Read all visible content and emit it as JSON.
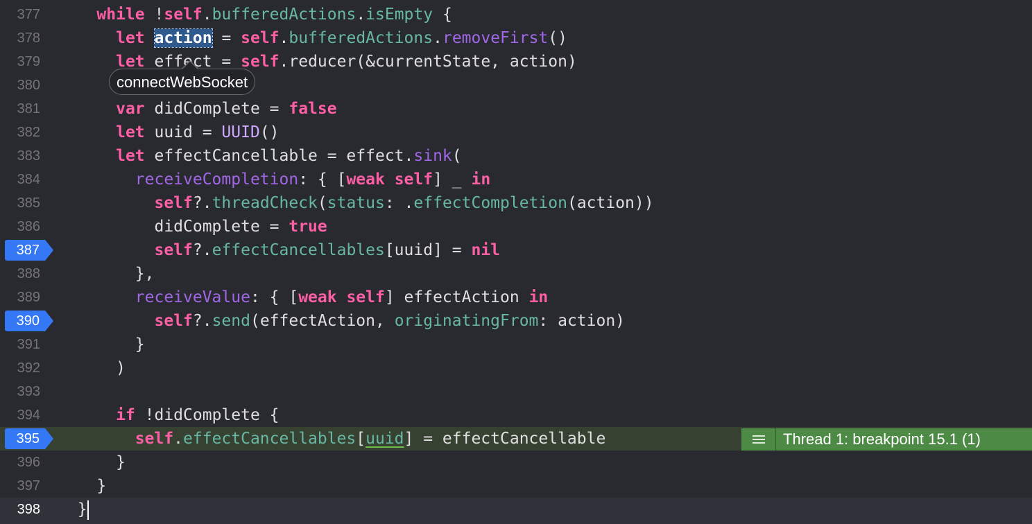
{
  "tooltip": {
    "text": "connectWebSocket"
  },
  "thread_badge": {
    "icon": "list-icon",
    "text": "Thread 1: breakpoint 15.1 (1)",
    "color": "#4d8a45"
  },
  "breakpoint_color": "#3478f6",
  "lines": [
    {
      "num": "377",
      "tokens": [
        [
          "p",
          "    "
        ],
        [
          "k",
          "while"
        ],
        [
          "p",
          " !"
        ],
        [
          "s",
          "self"
        ],
        [
          "p",
          "."
        ],
        [
          "r",
          "bufferedActions"
        ],
        [
          "p",
          "."
        ],
        [
          "r",
          "isEmpty"
        ],
        [
          "p",
          " {"
        ]
      ]
    },
    {
      "num": "378",
      "tokens": [
        [
          "p",
          "      "
        ],
        [
          "k",
          "let"
        ],
        [
          "p",
          " "
        ],
        [
          "x",
          "action"
        ],
        [
          "p",
          " = "
        ],
        [
          "s",
          "self"
        ],
        [
          "p",
          "."
        ],
        [
          "r",
          "bufferedActions"
        ],
        [
          "p",
          "."
        ],
        [
          "m",
          "removeFirst"
        ],
        [
          "p",
          "()"
        ]
      ]
    },
    {
      "num": "379",
      "tokens": [
        [
          "p",
          "      "
        ],
        [
          "k",
          "let"
        ],
        [
          "p",
          " effect = "
        ],
        [
          "s",
          "self"
        ],
        [
          "p",
          "."
        ],
        [
          "p",
          "reducer(&currentState, action)"
        ]
      ]
    },
    {
      "num": "380",
      "tokens": []
    },
    {
      "num": "381",
      "tokens": [
        [
          "p",
          "      "
        ],
        [
          "k",
          "var"
        ],
        [
          "p",
          " didComplete = "
        ],
        [
          "k",
          "false"
        ]
      ]
    },
    {
      "num": "382",
      "tokens": [
        [
          "p",
          "      "
        ],
        [
          "k",
          "let"
        ],
        [
          "p",
          " uuid = "
        ],
        [
          "t",
          "UUID"
        ],
        [
          "p",
          "()"
        ]
      ]
    },
    {
      "num": "383",
      "tokens": [
        [
          "p",
          "      "
        ],
        [
          "k",
          "let"
        ],
        [
          "p",
          " effectCancellable = effect."
        ],
        [
          "m",
          "sink"
        ],
        [
          "p",
          "("
        ]
      ]
    },
    {
      "num": "384",
      "tokens": [
        [
          "p",
          "        "
        ],
        [
          "m",
          "receiveCompletion"
        ],
        [
          "p",
          ": { ["
        ],
        [
          "k",
          "weak"
        ],
        [
          "p",
          " "
        ],
        [
          "s",
          "self"
        ],
        [
          "p",
          "] _ "
        ],
        [
          "k",
          "in"
        ]
      ]
    },
    {
      "num": "385",
      "tokens": [
        [
          "p",
          "          "
        ],
        [
          "s",
          "self"
        ],
        [
          "p",
          "?."
        ],
        [
          "r",
          "threadCheck"
        ],
        [
          "p",
          "("
        ],
        [
          "r",
          "status"
        ],
        [
          "p",
          ": ."
        ],
        [
          "r",
          "effectCompletion"
        ],
        [
          "p",
          "(action))"
        ]
      ]
    },
    {
      "num": "386",
      "tokens": [
        [
          "p",
          "          didComplete = "
        ],
        [
          "k",
          "true"
        ]
      ]
    },
    {
      "num": "387",
      "tokens": [
        [
          "p",
          "          "
        ],
        [
          "s",
          "self"
        ],
        [
          "p",
          "?."
        ],
        [
          "r",
          "effectCancellables"
        ],
        [
          "p",
          "[uuid] = "
        ],
        [
          "k",
          "nil"
        ]
      ],
      "breakpoint": true
    },
    {
      "num": "388",
      "tokens": [
        [
          "p",
          "        },"
        ]
      ]
    },
    {
      "num": "389",
      "tokens": [
        [
          "p",
          "        "
        ],
        [
          "m",
          "receiveValue"
        ],
        [
          "p",
          ": { ["
        ],
        [
          "k",
          "weak"
        ],
        [
          "p",
          " "
        ],
        [
          "s",
          "self"
        ],
        [
          "p",
          "] effectAction "
        ],
        [
          "k",
          "in"
        ]
      ]
    },
    {
      "num": "390",
      "tokens": [
        [
          "p",
          "          "
        ],
        [
          "s",
          "self"
        ],
        [
          "p",
          "?."
        ],
        [
          "r",
          "send"
        ],
        [
          "p",
          "(effectAction, "
        ],
        [
          "r",
          "originatingFrom"
        ],
        [
          "p",
          ": action)"
        ]
      ],
      "breakpoint": true
    },
    {
      "num": "391",
      "tokens": [
        [
          "p",
          "        }"
        ]
      ]
    },
    {
      "num": "392",
      "tokens": [
        [
          "p",
          "      )"
        ]
      ]
    },
    {
      "num": "393",
      "tokens": []
    },
    {
      "num": "394",
      "tokens": [
        [
          "p",
          "      "
        ],
        [
          "k",
          "if"
        ],
        [
          "p",
          " !didComplete {"
        ]
      ]
    },
    {
      "num": "395",
      "tokens": [
        [
          "p",
          "        "
        ],
        [
          "s",
          "self"
        ],
        [
          "p",
          "."
        ],
        [
          "r",
          "effectCancellables"
        ],
        [
          "p",
          "["
        ],
        [
          "u",
          "uuid"
        ],
        [
          "p",
          "] = effectCancellable"
        ]
      ],
      "breakpoint": true,
      "exec": true
    },
    {
      "num": "396",
      "tokens": [
        [
          "p",
          "      }"
        ]
      ]
    },
    {
      "num": "397",
      "tokens": [
        [
          "p",
          "    }"
        ]
      ]
    },
    {
      "num": "398",
      "tokens": [
        [
          "p",
          "  }"
        ],
        [
          "c",
          ""
        ]
      ],
      "current": true
    }
  ]
}
